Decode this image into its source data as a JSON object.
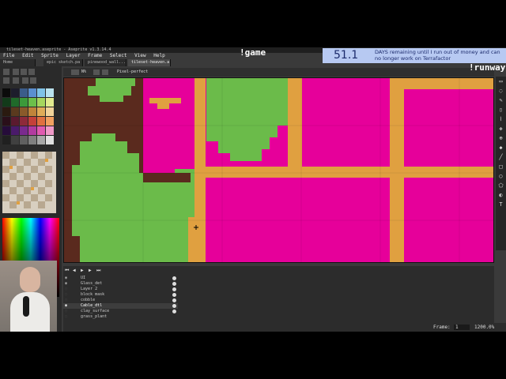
{
  "app": {
    "title": "tileset-heaven.aseprite - Aseprite v1.3.14.4",
    "menu": [
      "File",
      "Edit",
      "Sprite",
      "Layer",
      "Frame",
      "Select",
      "View",
      "Help"
    ],
    "tabs": [
      {
        "label": "Home",
        "active": false
      },
      {
        "label": "epic sketch.pa",
        "active": false
      },
      {
        "label": "pinewood_wall...",
        "active": false
      },
      {
        "label": "tileset-heaven.a",
        "active": true
      }
    ],
    "tool_options": {
      "mode": "N%",
      "pixel_perfect": "Pixel-perfect"
    }
  },
  "palette_colors": [
    "#0b0b0b",
    "#1d1d2c",
    "#3b5c8a",
    "#5a8fd0",
    "#7fc2e6",
    "#b9e2ee",
    "#123a1a",
    "#1f6a2a",
    "#3c9a3a",
    "#6cc04a",
    "#a6d65e",
    "#e1ea8f",
    "#2a1a10",
    "#5a3a1e",
    "#8a5a2a",
    "#c0843a",
    "#e0ac58",
    "#f1d39a",
    "#2a0f1a",
    "#5a1a2e",
    "#8e2a3a",
    "#c4403a",
    "#e07040",
    "#f2a060",
    "#260c3a",
    "#4a1a6a",
    "#7a2a8e",
    "#b23aa0",
    "#e05ab0",
    "#f09ac8",
    "#202020",
    "#404040",
    "#606060",
    "#808080",
    "#a8a8a8",
    "#e0e0e0"
  ],
  "layers": [
    {
      "name": "UI",
      "visible": true
    },
    {
      "name": "Glass_det",
      "visible": true
    },
    {
      "name": "Layer 2",
      "visible": false
    },
    {
      "name": "block mask",
      "visible": false
    },
    {
      "name": "cobble",
      "visible": false
    },
    {
      "name": "Cable_dtl",
      "visible": true
    },
    {
      "name": "clay_surface",
      "visible": false
    },
    {
      "name": "grass_plant",
      "visible": false
    }
  ],
  "status": {
    "frame_label": "Frame:",
    "frame_value": "1",
    "zoom": "1200.0%"
  },
  "stream": {
    "command_top": "!game",
    "counter_value": "51.1",
    "counter_text": "DAYS remaining until I run out of money and can no longer work on Terrafactor",
    "command_right": "!runway"
  },
  "colors": {
    "magenta": "#e6009a",
    "green": "#6bbb4a",
    "tan": "#e0a040",
    "brown": "#5a2a1e",
    "panel_dark": "#2a2a2a"
  }
}
